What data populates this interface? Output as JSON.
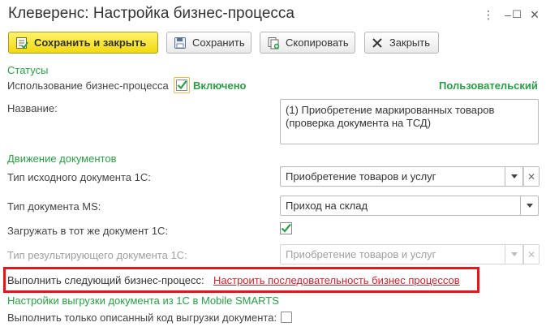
{
  "window": {
    "title": "Клеверенс: Настройка бизнес-процесса",
    "more_glyph": "⋮",
    "minimize_glyph": "–",
    "maximize_glyph": "☐",
    "close_glyph": "×"
  },
  "toolbar": {
    "save_close_label": "Сохранить и закрыть",
    "save_label": "Сохранить",
    "copy_label": "Скопировать",
    "close_label": "Закрыть"
  },
  "statuses": {
    "section_title": "Статусы",
    "usage_label": "Использование бизнес-процесса",
    "usage_checked": true,
    "usage_value": "Включено",
    "type_label": "Пользовательский"
  },
  "name": {
    "label": "Название:",
    "value": "(1) Приобретение маркированных товаров\n(проверка документа на ТСД)"
  },
  "documents": {
    "section_title": "Движение документов",
    "source_doc_label": "Тип исходного документа 1С:",
    "source_doc_value": "Приобретение товаров и услуг",
    "ms_doc_label": "Тип документа MS:",
    "ms_doc_value": "Приход на склад",
    "load_same_label": "Загружать в тот же документ 1С:",
    "load_same_checked": true,
    "result_doc_label": "Тип результирующего документа 1С:",
    "result_doc_value": "Приобретение товаров и услуг"
  },
  "next_process": {
    "label": "Выполнить следующий бизнес-процесс:",
    "link": "Настроить последовательность бизнес процессов",
    "highlight_color": "#e8141b"
  },
  "export": {
    "section_title": "Настройки выгрузки документа из 1С в Mobile SMARTS",
    "only_described_label": "Выполнить только описанный код выгрузки документа:",
    "only_described_checked": false
  },
  "colors": {
    "accent_green": "#2a9d45",
    "primary_button": "#f2d90f",
    "link_red": "#d0222b"
  }
}
